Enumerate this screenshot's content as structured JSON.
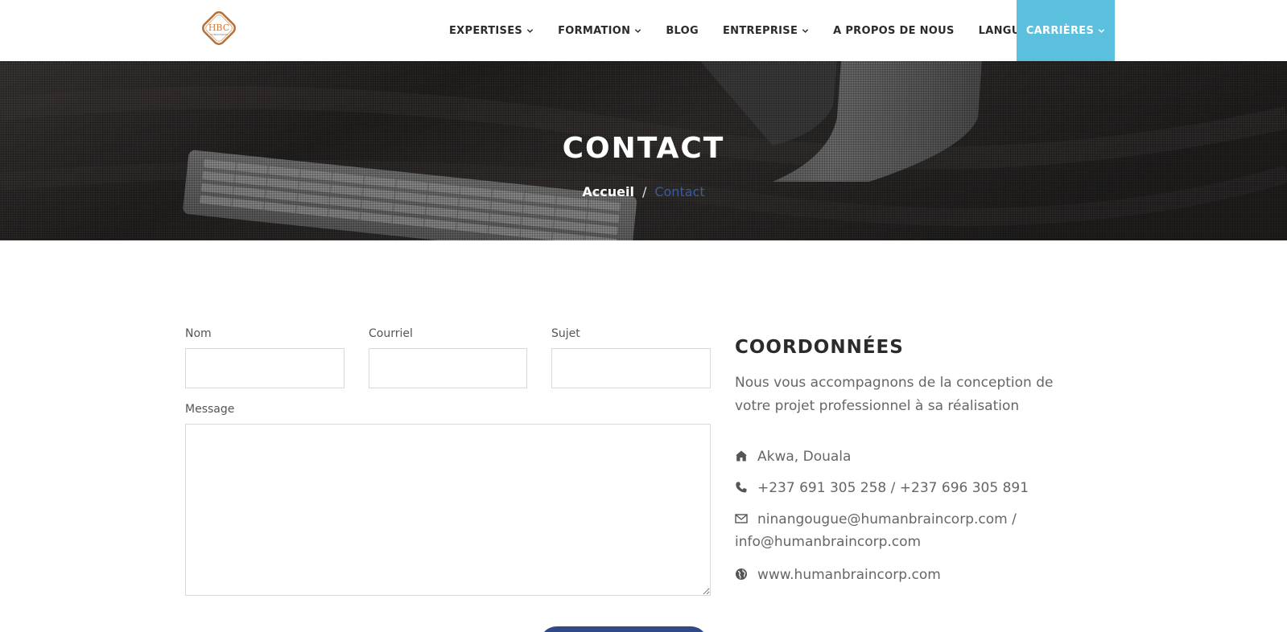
{
  "nav": {
    "items": [
      {
        "label": "EXPERTISES",
        "dropdown": true
      },
      {
        "label": "FORMATION",
        "dropdown": true
      },
      {
        "label": "BLOG",
        "dropdown": false
      },
      {
        "label": "ENTREPRISE",
        "dropdown": true
      },
      {
        "label": "A PROPOS DE NOUS",
        "dropdown": false
      },
      {
        "label": "LANGUE",
        "dropdown": true
      }
    ],
    "cta_label": "CARRIÈRES",
    "cta_color": "#5bc0de"
  },
  "hero": {
    "title": "CONTACT",
    "breadcrumb_home": "Accueil",
    "breadcrumb_sep": "/",
    "breadcrumb_current": "Contact"
  },
  "form": {
    "name_label": "Nom",
    "name_value": "",
    "email_label": "Courriel",
    "email_value": "",
    "subject_label": "Sujet",
    "subject_value": "",
    "message_label": "Message",
    "message_value": ""
  },
  "info": {
    "title": "COORDONNÉES",
    "description": "Nous vous accompagnons de la conception de votre projet professionnel à sa réalisation",
    "address": "Akwa, Douala",
    "phone": "+237 691 305 258 / +237 696 305 891",
    "email_line1": "ninangougue@humanbraincorp.com /",
    "email_line2": "info@humanbraincorp.com",
    "website": "www.humanbraincorp.com"
  },
  "colors": {
    "accent": "#5bc0de",
    "brand_blue": "#2f4a87",
    "breadcrumb_active": "#3c5a9a"
  }
}
